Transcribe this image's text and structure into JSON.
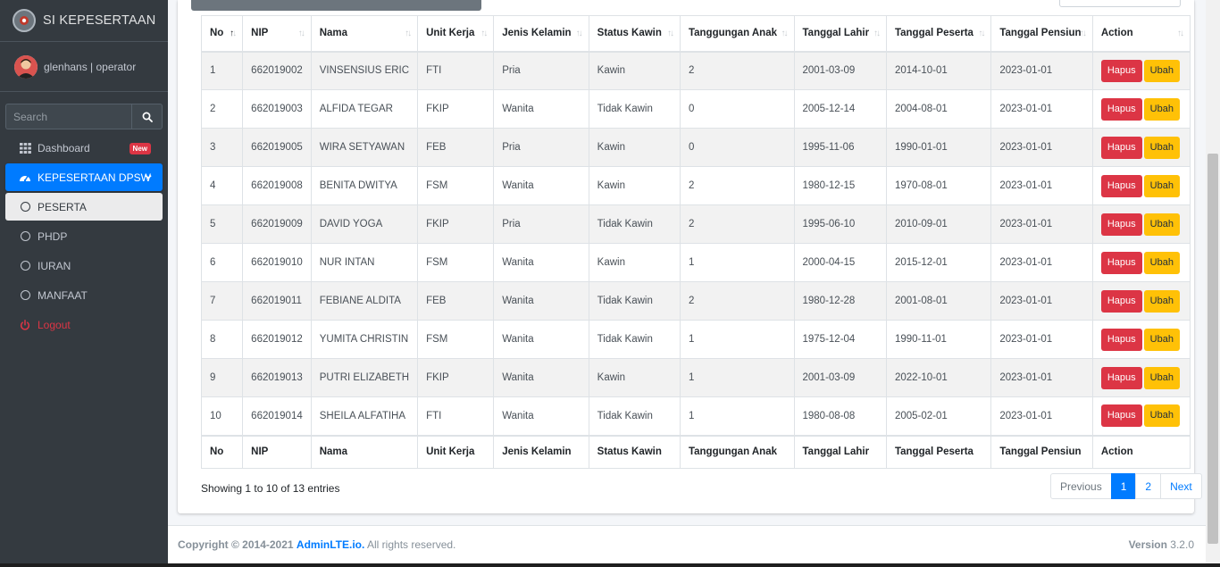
{
  "brand": {
    "title": "SI KEPESERTAAN"
  },
  "user": {
    "name": "glenhans | operator"
  },
  "search": {
    "placeholder": "Search"
  },
  "nav": {
    "dashboard": {
      "label": "Dashboard",
      "badge": "New"
    },
    "kepesertaan": {
      "label": "KEPESERTAAN DPSW"
    },
    "peserta": {
      "label": "PESERTA"
    },
    "phdp": {
      "label": "PHDP"
    },
    "iuran": {
      "label": "IURAN"
    },
    "manfaat": {
      "label": "MANFAAT"
    },
    "logout": {
      "label": "Logout"
    }
  },
  "table": {
    "columns": [
      "No",
      "NIP",
      "Nama",
      "Unit Kerja",
      "Jenis Kelamin",
      "Status Kawin",
      "Tanggungan Anak",
      "Tanggal Lahir",
      "Tanggal Peserta",
      "Tanggal Pensiun",
      "Action"
    ],
    "rows": [
      [
        "1",
        "662019002",
        "VINSENSIUS ERIC",
        "FTI",
        "Pria",
        "Kawin",
        "2",
        "2001-03-09",
        "2014-10-01",
        "2023-01-01"
      ],
      [
        "2",
        "662019003",
        "ALFIDA TEGAR",
        "FKIP",
        "Wanita",
        "Tidak Kawin",
        "0",
        "2005-12-14",
        "2004-08-01",
        "2023-01-01"
      ],
      [
        "3",
        "662019005",
        "WIRA SETYAWAN",
        "FEB",
        "Pria",
        "Kawin",
        "0",
        "1995-11-06",
        "1990-01-01",
        "2023-01-01"
      ],
      [
        "4",
        "662019008",
        "BENITA DWITYA",
        "FSM",
        "Wanita",
        "Kawin",
        "2",
        "1980-12-15",
        "1970-08-01",
        "2023-01-01"
      ],
      [
        "5",
        "662019009",
        "DAVID YOGA",
        "FKIP",
        "Pria",
        "Tidak Kawin",
        "2",
        "1995-06-10",
        "2010-09-01",
        "2023-01-01"
      ],
      [
        "6",
        "662019010",
        "NUR INTAN",
        "FSM",
        "Wanita",
        "Kawin",
        "1",
        "2000-04-15",
        "2015-12-01",
        "2023-01-01"
      ],
      [
        "7",
        "662019011",
        "FEBIANE ALDITA",
        "FEB",
        "Wanita",
        "Tidak Kawin",
        "2",
        "1980-12-28",
        "2001-08-01",
        "2023-01-01"
      ],
      [
        "8",
        "662019012",
        "YUMITA CHRISTIN",
        "FSM",
        "Wanita",
        "Tidak Kawin",
        "1",
        "1975-12-04",
        "1990-11-01",
        "2023-01-01"
      ],
      [
        "9",
        "662019013",
        "PUTRI ELIZABETH",
        "FKIP",
        "Wanita",
        "Kawin",
        "1",
        "2001-03-09",
        "2022-10-01",
        "2023-01-01"
      ],
      [
        "10",
        "662019014",
        "SHEILA ALFATIHA",
        "FTI",
        "Wanita",
        "Tidak Kawin",
        "1",
        "1980-08-08",
        "2005-02-01",
        "2023-01-01"
      ]
    ],
    "hapus_label": "Hapus",
    "ubah_label": "Ubah"
  },
  "pagination": {
    "info": "Showing 1 to 10 of 13 entries",
    "previous": "Previous",
    "pages": [
      "1",
      "2"
    ],
    "next": "Next"
  },
  "footer": {
    "copyright": "Copyright © 2014-2021",
    "link": "AdminLTE.io.",
    "rights": "All rights reserved.",
    "version_label": "Version",
    "version": "3.2.0"
  },
  "colors": {
    "primary": "#007bff",
    "danger": "#dc3545",
    "warning": "#ffc107",
    "sidebar": "#343a40"
  }
}
